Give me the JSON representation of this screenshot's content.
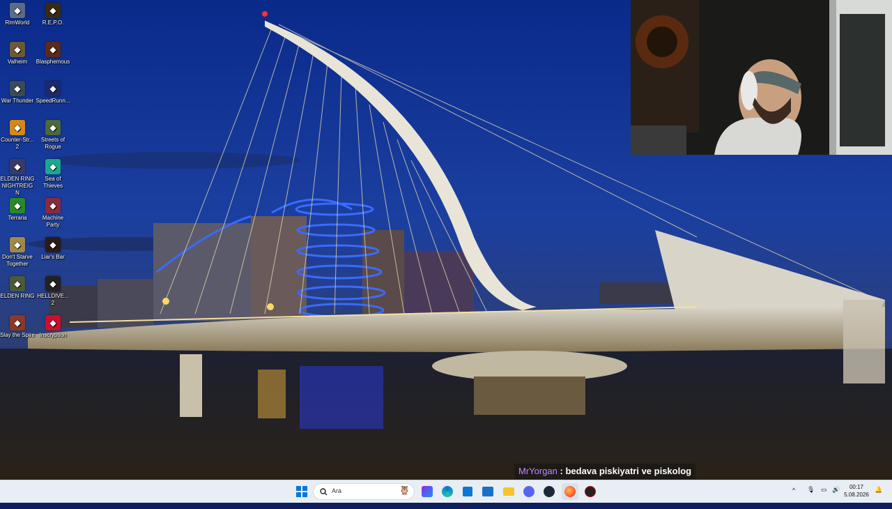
{
  "desktop_icons": [
    {
      "label": "RimWorld",
      "icon": "rimworld-icon",
      "color": "#5b6b8a"
    },
    {
      "label": "R.E.P.O.",
      "icon": "repo-icon",
      "color": "#3a2a12"
    },
    {
      "label": "Valheim",
      "icon": "valheim-icon",
      "color": "#6b5a3a"
    },
    {
      "label": "Blasphemous",
      "icon": "blasphemous-icon",
      "color": "#5a2a1a"
    },
    {
      "label": "War Thunder",
      "icon": "war-thunder-icon",
      "color": "#3a4a5a"
    },
    {
      "label": "SpeedRunn...",
      "icon": "speedrunners-icon",
      "color": "#1a2a6a"
    },
    {
      "label": "Counter-Str... 2",
      "icon": "counter-strike-icon",
      "color": "#d48a1a"
    },
    {
      "label": "Streets of Rogue",
      "icon": "streets-of-rogue-icon",
      "color": "#4a6a3a"
    },
    {
      "label": "ELDEN RING NIGHTREIGN",
      "icon": "elden-ring-nightreign-icon",
      "color": "#3a3a6a"
    },
    {
      "label": "Sea of Thieves",
      "icon": "sea-of-thieves-icon",
      "color": "#1aa890"
    },
    {
      "label": "Terraria",
      "icon": "terraria-icon",
      "color": "#2a8a2a"
    },
    {
      "label": "Machine Party",
      "icon": "machine-party-icon",
      "color": "#8a2a3a"
    },
    {
      "label": "Don't Starve Together",
      "icon": "dont-starve-icon",
      "color": "#a08a4a"
    },
    {
      "label": "Liar's Bar",
      "icon": "liars-bar-icon",
      "color": "#2a1a1a"
    },
    {
      "label": "ELDEN RING",
      "icon": "elden-ring-icon",
      "color": "#4a5a3a"
    },
    {
      "label": "HELLDIVE... 2",
      "icon": "helldivers-icon",
      "color": "#222222"
    },
    {
      "label": "Slay the Spire",
      "icon": "slay-the-spire-icon",
      "color": "#8a3a2a"
    },
    {
      "label": "Inscryption",
      "icon": "inscryption-icon",
      "color": "#c8102e"
    }
  ],
  "chat": {
    "user": "MrYorgan",
    "separator": " : ",
    "message": "bedava piskiyatri ve piskolog",
    "user_color": "#b98cff"
  },
  "taskbar": {
    "search_placeholder": "Ara",
    "apps": [
      "start-icon",
      "search-icon",
      "widgets-icon",
      "edge-icon",
      "store-icon",
      "outlook-icon",
      "file-explorer-icon",
      "discord-icon",
      "steam-icon",
      "firefox-icon",
      "app-icon"
    ],
    "clock_time": "00:17",
    "clock_date": "5.08.2026"
  }
}
